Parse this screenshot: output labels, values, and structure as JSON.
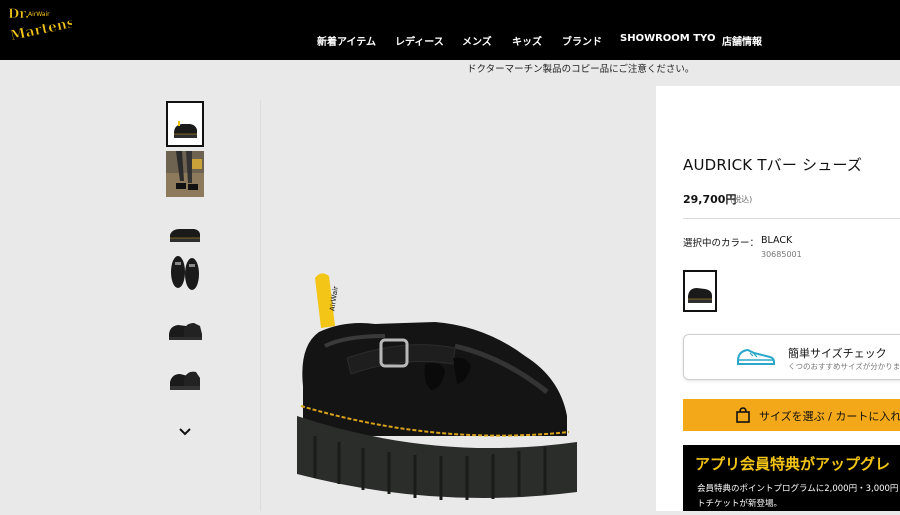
{
  "brand": {
    "logo_text_top": "Dr.",
    "logo_text_main": "Martens",
    "logo_text_small": "AirWair"
  },
  "nav": {
    "items": [
      "新着アイテム",
      "レディース",
      "メンズ",
      "キッズ",
      "ブランド",
      "SHOWROOM TYO",
      "店舗情報"
    ]
  },
  "notice": "ドクターマーチン製品のコピー品にご注意ください。",
  "gallery": {
    "thumbnails": [
      "shoe-pair-angle",
      "model-wearing-photo",
      "shoe-side-view",
      "shoe-top-view",
      "shoe-three-quarter",
      "shoe-sole-view"
    ],
    "more_icon": "chevron-down-icon",
    "main_image": "black-t-bar-platform-shoe"
  },
  "product": {
    "title": "AUDRICK Tバー シューズ",
    "price": "29,700円",
    "tax_note": "(税込)",
    "color_label": "選択中のカラー：",
    "color_value": "BLACK",
    "sku": "30685001"
  },
  "size_check": {
    "title": "簡単サイズチェック",
    "subtitle": "くつのおすすめサイズが分かりま",
    "icon": "sneaker-outline-icon"
  },
  "cart": {
    "label": "サイズを選ぶ / カートに入れ",
    "icon": "shopping-bag-icon"
  },
  "promo": {
    "title": "アプリ会員特典がアップグレ",
    "line1": "会員特典のポイントプログラムに2,000円・3,000円",
    "line2": "トチケットが新登場。"
  },
  "colors": {
    "header_bg": "#000000",
    "page_bg": "#e9e9e9",
    "cart_button": "#f3a81a",
    "promo_title": "#f3c516",
    "size_icon": "#2aa7c9"
  }
}
